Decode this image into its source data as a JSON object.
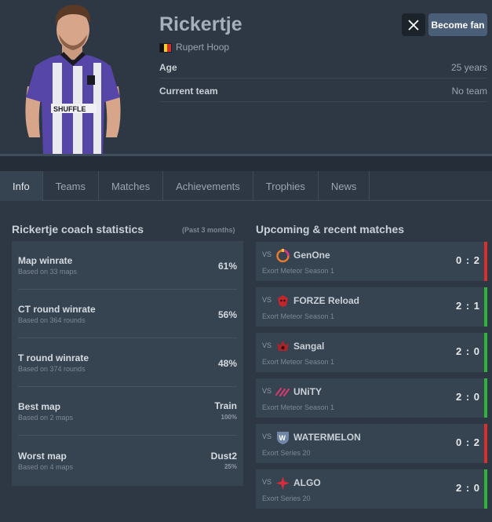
{
  "player": {
    "nickname": "Rickertje",
    "real_name": "Rupert Hoop",
    "country_flag_colors": [
      "#111111",
      "#f5d21a",
      "#d62d2d"
    ],
    "age_label": "Age",
    "age_value": "25 years",
    "team_label": "Current team",
    "team_value": "No team"
  },
  "header": {
    "x_icon": "x-logo-icon",
    "fan_button": "Become fan"
  },
  "tabs": [
    {
      "label": "Info",
      "active": true
    },
    {
      "label": "Teams"
    },
    {
      "label": "Matches"
    },
    {
      "label": "Achievements"
    },
    {
      "label": "Trophies"
    },
    {
      "label": "News"
    }
  ],
  "stats": {
    "title": "Rickertje coach statistics",
    "period": "(Past 3 months)",
    "items": [
      {
        "title": "Map winrate",
        "sub": "Based on 33 maps",
        "value": "61%",
        "pct": ""
      },
      {
        "title": "CT round winrate",
        "sub": "Based on 364 rounds",
        "value": "56%",
        "pct": ""
      },
      {
        "title": "T round winrate",
        "sub": "Based on 374 rounds",
        "value": "48%",
        "pct": ""
      },
      {
        "title": "Best map",
        "sub": "Based on 2 maps",
        "value": "Train",
        "pct": "100%"
      },
      {
        "title": "Worst map",
        "sub": "Based on 4 maps",
        "value": "Dust2",
        "pct": "25%"
      }
    ]
  },
  "matches": {
    "title": "Upcoming & recent matches",
    "vs_label": "VS",
    "items": [
      {
        "team": "GenOne",
        "event": "Exort Meteor Season 1",
        "score": "0 : 2",
        "result_color": "#d9302c",
        "logo": "genone-logo-icon"
      },
      {
        "team": "FORZE Reload",
        "event": "Exort Meteor Season 1",
        "score": "2 : 1",
        "result_color": "#2fb33a",
        "logo": "forze-logo-icon"
      },
      {
        "team": "Sangal",
        "event": "Exort Meteor Season 1",
        "score": "2 : 0",
        "result_color": "#2fb33a",
        "logo": "sangal-logo-icon"
      },
      {
        "team": "UNiTY",
        "event": "Exort Meteor Season 1",
        "score": "2 : 0",
        "result_color": "#2fb33a",
        "logo": "unity-logo-icon"
      },
      {
        "team": "WATERMELON",
        "event": "Exort Series 20",
        "score": "0 : 2",
        "result_color": "#d9302c",
        "logo": "watermelon-logo-icon"
      },
      {
        "team": "ALGO",
        "event": "Exort Series 20",
        "score": "2 : 0",
        "result_color": "#2fb33a",
        "logo": "algo-logo-icon"
      }
    ]
  }
}
